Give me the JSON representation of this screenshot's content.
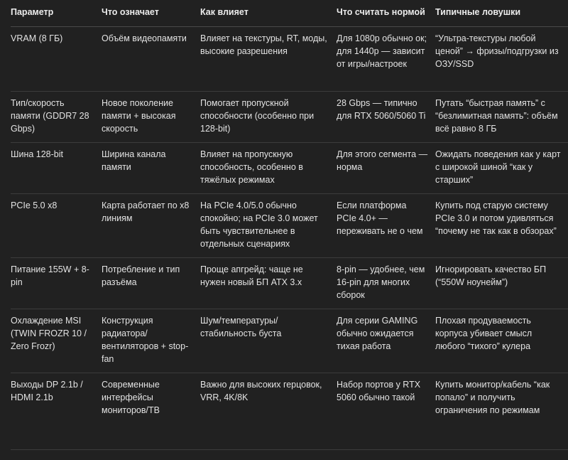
{
  "table": {
    "headers": [
      "Параметр",
      "Что означает",
      "Как влияет",
      "Что считать нормой",
      "Типичные ловушки"
    ],
    "rows": [
      {
        "param": "VRAM (8 ГБ)",
        "meaning": "Объём видеопамяти",
        "impact": "Влияет на текстуры, RT, моды, высокие разрешения",
        "normal": "Для 1080p обычно ок; для 1440p — зависит от игры/настроек",
        "pitfalls": "“Ультра-текстуры любой ценой” → фризы/подгрузки из ОЗУ/SSD"
      },
      {
        "param": "Тип/скорость памяти (GDDR7 28 Gbps)",
        "meaning": "Новое поколение памяти + высокая скорость",
        "impact": "Помогает пропускной способности (особенно при 128-bit)",
        "normal": "28 Gbps — типично для RTX 5060/5060 Ti",
        "pitfalls": "Путать “быстрая память” с “безлимитная память”: объём всё равно 8 ГБ"
      },
      {
        "param": "Шина 128-bit",
        "meaning": "Ширина канала памяти",
        "impact": "Влияет на пропускную способность, особенно в тяжёлых режимах",
        "normal": "Для этого сегмента — норма",
        "pitfalls": "Ожидать поведения как у карт с широкой шиной “как у старших”"
      },
      {
        "param": "PCIe 5.0 x8",
        "meaning": "Карта работает по x8 линиям",
        "impact": "На PCIe 4.0/5.0 обычно спокойно; на PCIe 3.0 может быть чувствительнее в отдельных сценариях",
        "normal": "Если платформа PCIe 4.0+ — переживать не о чем",
        "pitfalls": "Купить под старую систему PCIe 3.0 и потом удивляться “почему не так как в обзорах”"
      },
      {
        "param": "Питание 155W + 8-pin",
        "meaning": "Потребление и тип разъёма",
        "impact": "Проще апгрейд: чаще не нужен новый БП ATX 3.x",
        "normal": "8-pin — удобнее, чем 16-pin для многих сборок",
        "pitfalls": "Игнорировать качество БП (“550W ноунейм”)"
      },
      {
        "param": "Охлаждение MSI (TWIN FROZR 10 / Zero Frozr)",
        "meaning": "Конструкция радиатора/вентиляторов + stop-fan",
        "impact": "Шум/температуры/стабильность буста",
        "normal": "Для серии GAMING обычно ожидается тихая работа",
        "pitfalls": "Плохая продуваемость корпуса убивает смысл любого “тихого” кулера"
      },
      {
        "param": "Выходы DP 2.1b / HDMI 2.1b",
        "meaning": "Современные интерфейсы мониторов/ТВ",
        "impact": "Важно для высоких герцовок, VRR, 4K/8K",
        "normal": "Набор портов у RTX 5060 обычно такой",
        "pitfalls": "Купить монитор/кабель “как попало” и получить ограничения по режимам"
      }
    ]
  }
}
